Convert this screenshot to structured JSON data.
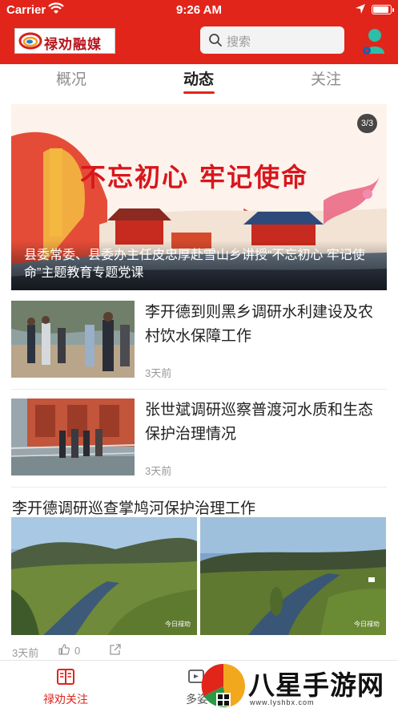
{
  "status_bar": {
    "carrier": "Carrier",
    "time": "9:26 AM",
    "battery_level": 0.95
  },
  "header": {
    "logo_text": "禄劝融媒",
    "search_placeholder": "搜索",
    "brand_color": "#e1251b"
  },
  "tabs": [
    {
      "label": "概况",
      "active": false
    },
    {
      "label": "动态",
      "active": true
    },
    {
      "label": "关注",
      "active": false
    }
  ],
  "banner": {
    "counter": "3/3",
    "slogan": "不忘初心 牢记使命",
    "caption": "县委常委、县委办主任皮忠厚赴雪山乡讲授“不忘初心 牢记使命”主题教育专题党课"
  },
  "news": [
    {
      "title": "李开德到则黑乡调研水利建设及农村饮水保障工作",
      "time": "3天前"
    },
    {
      "title": "张世斌调研巡察普渡河水质和生态保护治理情况",
      "time": "3天前"
    }
  ],
  "article": {
    "title": "李开德调研巡查掌鸠河保护治理工作",
    "photo_mark": "今日禄劝",
    "time": "3天前",
    "likes": "0"
  },
  "tabbar": [
    {
      "label": "禄劝关注",
      "icon": "book-icon",
      "active": true
    },
    {
      "label": "多姿",
      "icon": "tv-icon",
      "active": false
    }
  ],
  "watermark": {
    "text": "八星手游网",
    "url": "www.lyshbx.com"
  }
}
